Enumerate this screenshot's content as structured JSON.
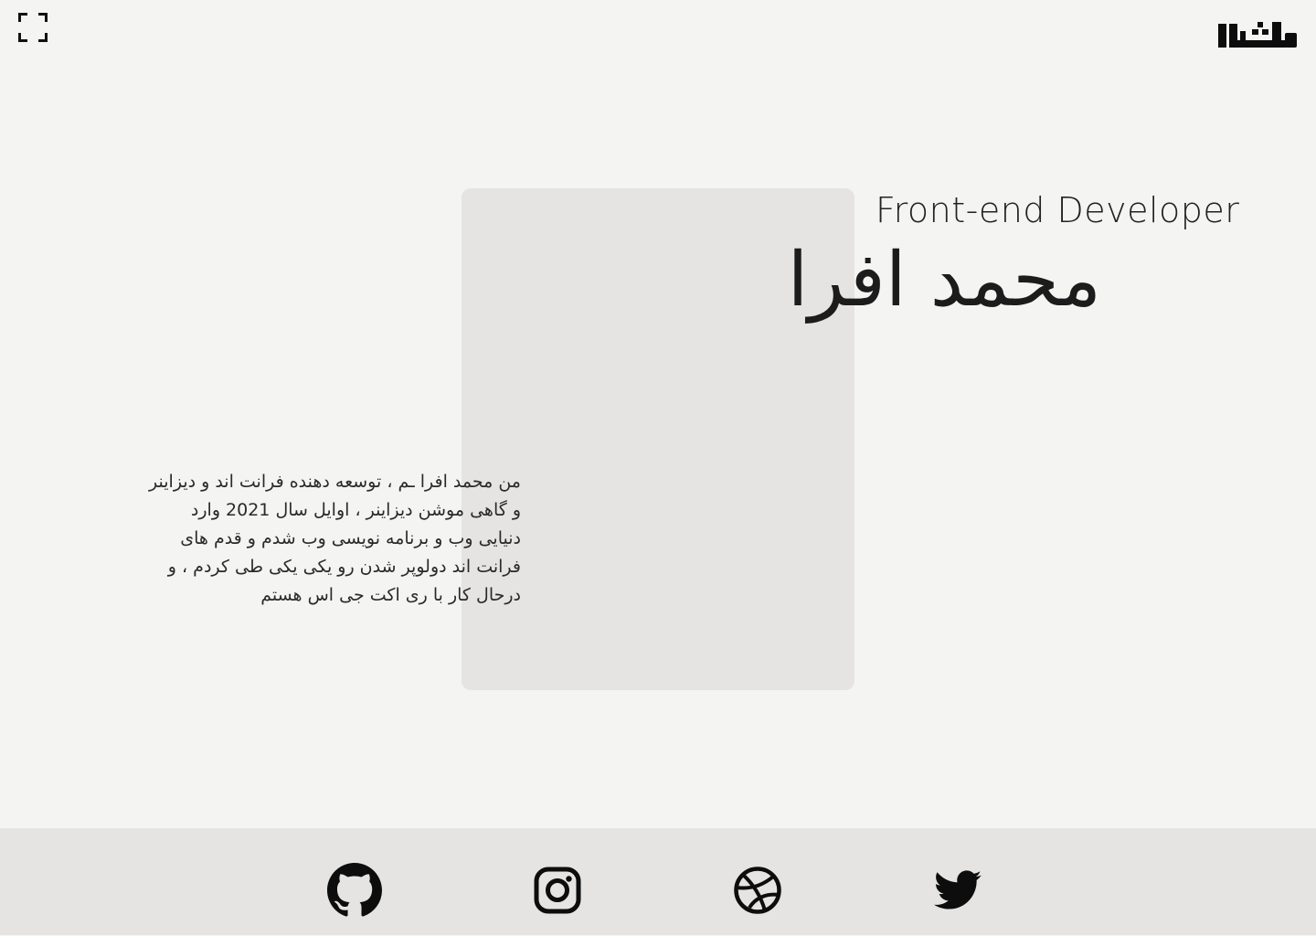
{
  "header": {
    "fullscreen_icon": "fullscreen-icon",
    "logo_text": "افرا"
  },
  "hero": {
    "role": "Front-end Developer",
    "name": "محمد افرا"
  },
  "about": {
    "bio": "من محمد افرا ـم ، توسعه دهنده فرانت اند و دیزاینر و گاهی موشن دیزاینر ، اوایل سال 2021 وارد دنیایی وب و برنامه نویسی وب شدم و قدم های فرانت اند دولوپر شدن رو یکی یکی طی کردم ،  و درحال کار با ری اکت جی اس هستم"
  },
  "footer": {
    "social": [
      {
        "icon": "github-icon"
      },
      {
        "icon": "instagram-icon"
      },
      {
        "icon": "dribbble-icon"
      },
      {
        "icon": "twitter-icon"
      }
    ]
  }
}
